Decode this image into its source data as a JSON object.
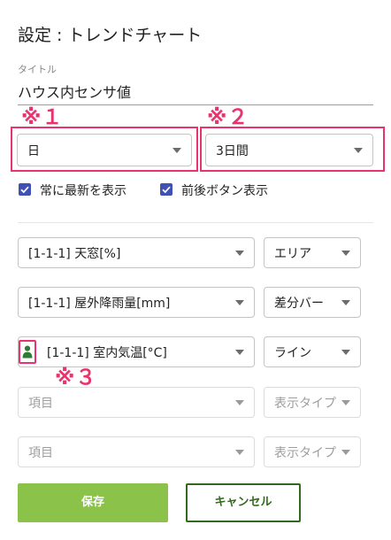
{
  "header": {
    "title": "設定 : トレンドチャート"
  },
  "title_field": {
    "label": "タイトル",
    "value": "ハウス内センサ値"
  },
  "notes": {
    "n1": "※１",
    "n2": "※２",
    "n3": "※３"
  },
  "period": {
    "unit": "日",
    "range": "3日間"
  },
  "options": {
    "always_latest": "常に最新を表示",
    "nav_buttons": "前後ボタン表示"
  },
  "series": [
    {
      "item": "[1-1-1] 天窓[%]",
      "type": "エリア"
    },
    {
      "item": "[1-1-1] 屋外降雨量[mm]",
      "type": "差分バー"
    },
    {
      "item": "[1-1-1] 室内気温[°C]",
      "type": "ライン"
    },
    {
      "item_placeholder": "項目",
      "type_placeholder": "表示タイプ"
    },
    {
      "item_placeholder": "項目",
      "type_placeholder": "表示タイプ"
    }
  ],
  "actions": {
    "save": "保存",
    "cancel": "キャンセル"
  },
  "colors": {
    "accent_pink": "#e8336d",
    "save_green": "#8bc34a",
    "cancel_green": "#33691e",
    "checkbox": "#3f51b5",
    "person_icon": "#2e7d32"
  }
}
